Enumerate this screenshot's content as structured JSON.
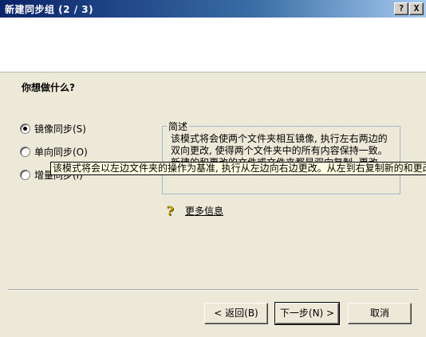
{
  "window": {
    "title": "新建同步组 (2 / 3)",
    "help_btn": "?",
    "close_btn": "X"
  },
  "heading": "你想做什么?",
  "options": [
    {
      "label": "镜像同步(S)",
      "checked": true
    },
    {
      "label": "单向同步(O)",
      "checked": false
    },
    {
      "label": "增量同步(I)",
      "checked": false
    }
  ],
  "description": {
    "legend": "简述",
    "text": "该模式将会使两个文件夹相互镜像, 执行左右两边的双向更改, 使得两个文件夹中的所有内容保持一致。新建的和更改的文件或文件夹都是双向复制, 更改"
  },
  "tooltip": "该模式将会以左边文件夹的操作为基准, 执行从左边向右边更改。从左到右复制新的和更改的文件",
  "more_info": "更多信息",
  "buttons": {
    "back": "< 返回(B)",
    "next": "下一步(N) >",
    "cancel": "取消"
  }
}
